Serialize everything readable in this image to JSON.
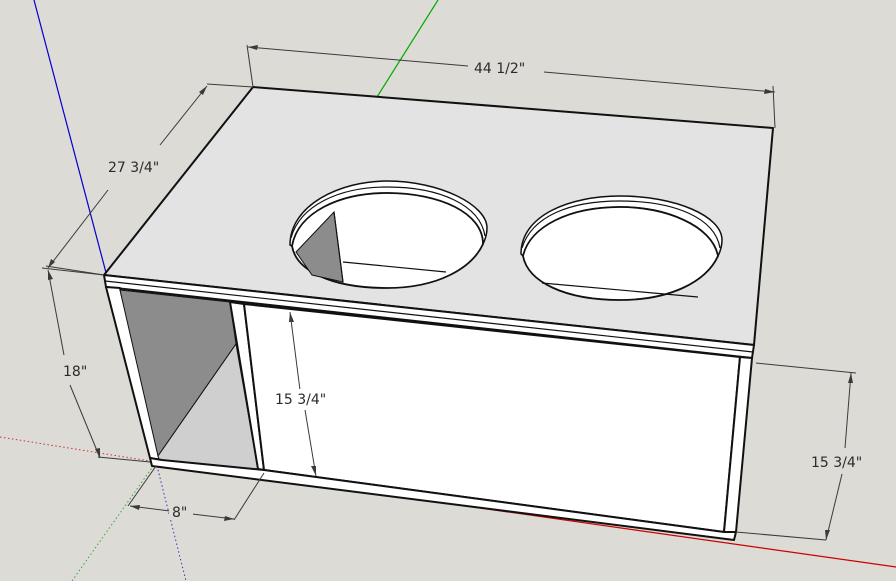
{
  "colors": {
    "background": "#dddbd6",
    "panel_top": "#e3e3e3",
    "panel_front": "#ffffff",
    "panel_shadow": "#8c8c8c",
    "panel_inner": "#cfcfcf",
    "axis_red": "#cc0000",
    "axis_green": "#00aa00",
    "axis_blue": "#0000cc"
  },
  "dimensions": {
    "width": "44 1/2\"",
    "depth": "27 3/4\"",
    "height": "18\"",
    "inner_height": "15 3/4\"",
    "outer_side_height": "15 3/4\"",
    "port_width": "8\""
  }
}
